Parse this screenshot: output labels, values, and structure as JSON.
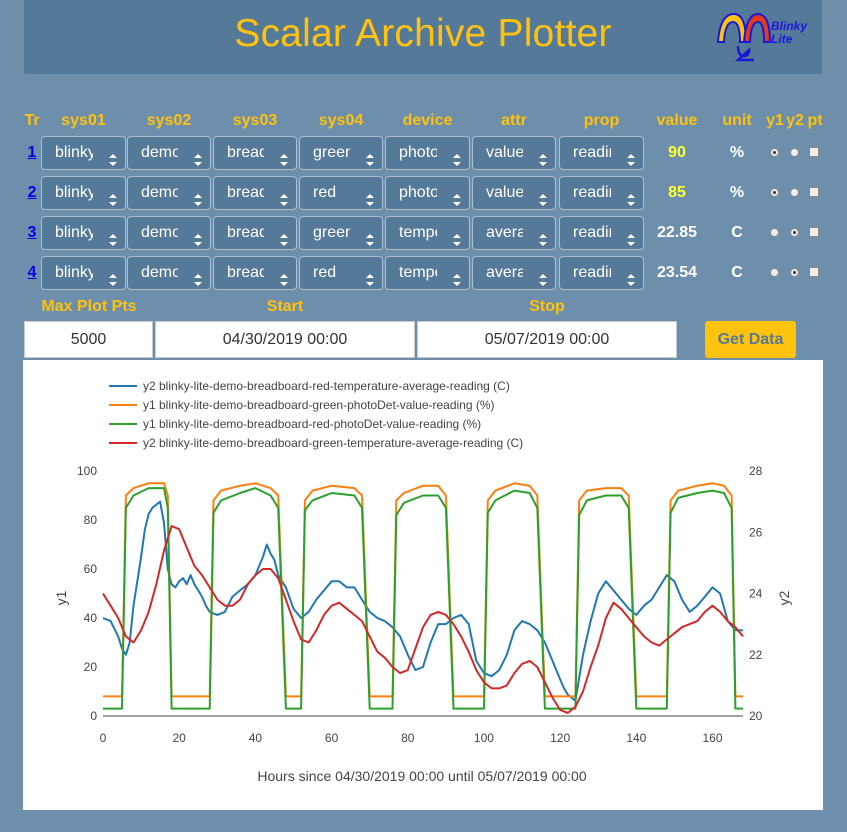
{
  "app": {
    "title": "Scalar Archive Plotter",
    "logo_text_1": "Blinky",
    "logo_text_2": "Lite"
  },
  "colors": {
    "accent": "#ffc20e",
    "panel": "#557a99",
    "background": "#6e8fab",
    "link": "#0000ee",
    "value_highlight": "#ffff33"
  },
  "table": {
    "headers": [
      "Tr",
      "sys01",
      "sys02",
      "sys03",
      "sys04",
      "device",
      "attr",
      "prop",
      "value",
      "unit",
      "y1",
      "y2",
      "pt"
    ],
    "rows": [
      {
        "tr": "1",
        "sys01": "blinky",
        "sys02": "demo",
        "sys03": "bread",
        "sys04": "green",
        "device": "photol",
        "attr": "value",
        "prop": "readin",
        "value": "90",
        "unit": "%",
        "y1": true,
        "y2": false,
        "pt": false,
        "highlight": true
      },
      {
        "tr": "2",
        "sys01": "blinky",
        "sys02": "demo",
        "sys03": "bread",
        "sys04": "red",
        "device": "photol",
        "attr": "value",
        "prop": "readin",
        "value": "85",
        "unit": "%",
        "y1": true,
        "y2": false,
        "pt": false,
        "highlight": true
      },
      {
        "tr": "3",
        "sys01": "blinky",
        "sys02": "demo",
        "sys03": "bread",
        "sys04": "green",
        "device": "tempe",
        "attr": "avera(",
        "prop": "readin",
        "value": "22.85",
        "unit": "C",
        "y1": false,
        "y2": true,
        "pt": false,
        "highlight": false
      },
      {
        "tr": "4",
        "sys01": "blinky",
        "sys02": "demo",
        "sys03": "bread",
        "sys04": "red",
        "device": "tempe",
        "attr": "avera(",
        "prop": "readin",
        "value": "23.54",
        "unit": "C",
        "y1": false,
        "y2": true,
        "pt": false,
        "highlight": false
      }
    ]
  },
  "controls": {
    "max_plot_pts_label": "Max Plot Pts",
    "start_label": "Start",
    "stop_label": "Stop",
    "max_plot_pts": "5000",
    "start": "04/30/2019 00:00",
    "stop": "05/07/2019 00:00",
    "get_data_label": "Get Data"
  },
  "chart_data": {
    "type": "line",
    "xlabel": "Hours since 04/30/2019 00:00 until 05/07/2019 00:00",
    "ylabel": "y1",
    "y2label": "y2",
    "xlim": [
      0,
      168
    ],
    "ylim": [
      0,
      100
    ],
    "y2lim": [
      20,
      28
    ],
    "xticks": [
      0,
      20,
      40,
      60,
      80,
      100,
      120,
      140,
      160
    ],
    "yticks": [
      0,
      20,
      40,
      60,
      80,
      100
    ],
    "y2ticks": [
      20,
      22,
      24,
      26,
      28
    ],
    "legend_position": "top-left",
    "series": [
      {
        "name": "y2 blinky-lite-demo-breadboard-red-temperature-average-reading (C)",
        "axis": "y2",
        "color": "#1f77b4",
        "x": [
          0,
          2,
          4,
          5,
          6,
          7,
          8,
          9,
          10,
          11,
          12,
          13,
          14,
          15,
          16,
          17,
          18,
          19,
          20,
          21,
          22,
          23,
          24,
          25,
          26,
          27,
          28,
          30,
          32,
          34,
          36,
          38,
          40,
          42,
          43,
          44,
          45,
          46,
          48,
          50,
          52,
          54,
          56,
          58,
          60,
          62,
          64,
          66,
          68,
          70,
          72,
          74,
          76,
          78,
          80,
          82,
          84,
          86,
          88,
          90,
          92,
          94,
          96,
          98,
          100,
          102,
          104,
          106,
          108,
          110,
          112,
          114,
          116,
          118,
          120,
          121,
          122,
          124,
          126,
          128,
          130,
          132,
          134,
          136,
          138,
          140,
          142,
          144,
          146,
          148,
          150,
          152,
          154,
          156,
          158,
          160,
          162,
          164,
          166,
          168
        ],
        "y": [
          23.2,
          23.1,
          22.6,
          22.2,
          22.0,
          22.4,
          23.6,
          24.4,
          25.2,
          26.1,
          26.6,
          26.8,
          26.9,
          27.0,
          26.3,
          24.8,
          24.3,
          24.2,
          24.4,
          24.5,
          24.3,
          24.6,
          24.3,
          24.1,
          23.9,
          23.6,
          23.4,
          23.3,
          23.4,
          23.9,
          24.1,
          24.3,
          24.6,
          25.2,
          25.6,
          25.3,
          25.1,
          24.6,
          24.2,
          23.5,
          23.2,
          23.4,
          23.8,
          24.1,
          24.4,
          24.4,
          24.2,
          24.2,
          23.8,
          23.4,
          23.2,
          23.1,
          22.9,
          22.6,
          22.0,
          21.5,
          21.6,
          22.4,
          23.0,
          23.0,
          23.2,
          23.3,
          23.0,
          21.8,
          21.4,
          21.3,
          21.5,
          22.0,
          22.8,
          23.1,
          23.0,
          22.8,
          22.4,
          21.8,
          21.2,
          20.9,
          20.7,
          20.5,
          22.0,
          23.1,
          24.0,
          24.4,
          24.1,
          23.8,
          23.5,
          23.3,
          23.6,
          23.8,
          24.2,
          24.6,
          24.4,
          23.8,
          23.4,
          23.6,
          23.9,
          24.2,
          24.0,
          23.1,
          22.8,
          22.8
        ]
      },
      {
        "name": "y1 blinky-lite-demo-breadboard-green-photoDet-value-reading (%)",
        "axis": "y1",
        "color": "#ff7f0e",
        "x": [
          0,
          4,
          5,
          6,
          8,
          12,
          16,
          17,
          18,
          20,
          24,
          26,
          28,
          29,
          31,
          36,
          40,
          44,
          46,
          48,
          50,
          52,
          53,
          55,
          60,
          66,
          68,
          70,
          72,
          76,
          77,
          79,
          84,
          88,
          90,
          92,
          94,
          96,
          100,
          101,
          103,
          108,
          112,
          114,
          116,
          118,
          120,
          124,
          125,
          127,
          132,
          136,
          138,
          140,
          142,
          144,
          148,
          149,
          151,
          156,
          160,
          163,
          165,
          166,
          168
        ],
        "y": [
          8,
          8,
          8,
          90,
          93,
          95,
          95,
          90,
          8,
          8,
          8,
          8,
          8,
          88,
          92,
          94,
          95,
          93,
          90,
          8,
          8,
          8,
          88,
          92,
          94,
          93,
          90,
          8,
          8,
          8,
          88,
          91,
          94,
          94,
          90,
          8,
          8,
          8,
          8,
          88,
          92,
          95,
          94,
          90,
          8,
          8,
          8,
          8,
          88,
          92,
          93,
          93,
          90,
          8,
          8,
          8,
          8,
          88,
          92,
          94,
          95,
          94,
          90,
          8,
          8
        ]
      },
      {
        "name": "y1 blinky-lite-demo-breadboard-red-photoDet-value-reading (%)",
        "axis": "y1",
        "color": "#2ca02c",
        "x": [
          0,
          4,
          5,
          6,
          8,
          12,
          16,
          17,
          18,
          20,
          24,
          26,
          28,
          29,
          31,
          36,
          40,
          44,
          46,
          48,
          50,
          52,
          53,
          55,
          60,
          66,
          68,
          70,
          72,
          76,
          77,
          79,
          84,
          88,
          90,
          92,
          94,
          96,
          100,
          101,
          103,
          108,
          112,
          114,
          116,
          118,
          120,
          124,
          125,
          127,
          132,
          136,
          138,
          140,
          142,
          144,
          148,
          149,
          151,
          156,
          160,
          163,
          165,
          166,
          168
        ],
        "y": [
          3,
          3,
          3,
          85,
          90,
          93,
          93,
          85,
          3,
          3,
          3,
          3,
          3,
          83,
          88,
          91,
          93,
          90,
          85,
          3,
          3,
          3,
          84,
          88,
          91,
          90,
          85,
          3,
          3,
          3,
          82,
          87,
          90,
          90,
          85,
          3,
          3,
          3,
          3,
          83,
          88,
          92,
          91,
          85,
          3,
          3,
          3,
          3,
          82,
          88,
          90,
          90,
          85,
          3,
          3,
          3,
          3,
          83,
          89,
          91,
          92,
          91,
          85,
          3,
          3
        ]
      },
      {
        "name": "y2 blinky-lite-demo-breadboard-green-temperature-average-reading (C)",
        "axis": "y2",
        "color": "#d62728",
        "x": [
          0,
          2,
          4,
          6,
          8,
          10,
          12,
          14,
          16,
          18,
          20,
          22,
          24,
          26,
          28,
          30,
          32,
          34,
          36,
          38,
          40,
          42,
          44,
          46,
          48,
          50,
          52,
          54,
          56,
          58,
          60,
          62,
          64,
          66,
          68,
          70,
          72,
          74,
          76,
          78,
          80,
          82,
          84,
          86,
          88,
          90,
          92,
          94,
          96,
          98,
          100,
          102,
          104,
          106,
          108,
          110,
          112,
          114,
          116,
          118,
          120,
          122,
          124,
          126,
          128,
          130,
          132,
          134,
          136,
          138,
          140,
          142,
          144,
          146,
          148,
          150,
          152,
          154,
          156,
          158,
          160,
          162,
          164,
          166,
          168
        ],
        "y": [
          24.0,
          23.6,
          23.2,
          22.6,
          22.4,
          22.8,
          23.4,
          24.3,
          25.4,
          26.2,
          26.1,
          25.5,
          24.9,
          24.6,
          24.2,
          23.8,
          23.6,
          23.6,
          23.8,
          24.3,
          24.6,
          24.8,
          24.8,
          24.5,
          23.8,
          23.1,
          22.5,
          22.4,
          22.8,
          23.3,
          23.6,
          23.7,
          23.5,
          23.3,
          23.1,
          22.6,
          22.1,
          21.9,
          21.6,
          21.4,
          21.5,
          22.2,
          22.9,
          23.3,
          23.4,
          23.3,
          23.0,
          22.6,
          22.1,
          21.5,
          21.1,
          20.9,
          20.9,
          21.0,
          21.4,
          21.7,
          21.8,
          21.6,
          21.1,
          20.6,
          20.2,
          20.1,
          20.3,
          20.8,
          21.6,
          22.3,
          23.2,
          23.7,
          23.5,
          23.2,
          22.9,
          22.6,
          22.4,
          22.3,
          22.5,
          22.7,
          22.9,
          23.0,
          23.1,
          23.4,
          23.6,
          23.4,
          23.1,
          22.9,
          22.6
        ]
      }
    ]
  }
}
